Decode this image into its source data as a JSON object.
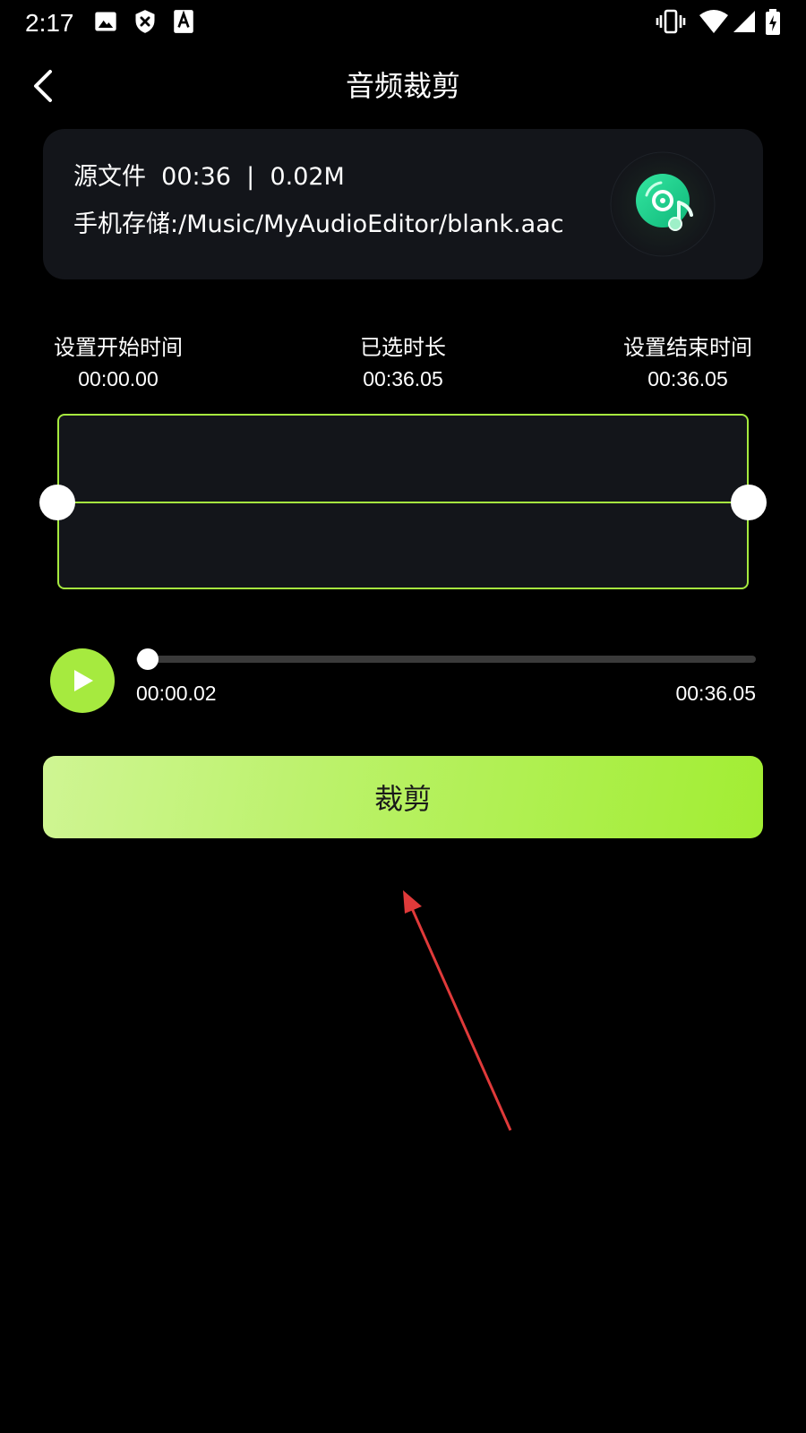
{
  "status_bar": {
    "time": "2:17",
    "left_icons": [
      "image-icon",
      "shield-x-icon",
      "font-a-icon"
    ],
    "right_icons": [
      "vibrate-icon",
      "wifi-icon",
      "signal-icon",
      "battery-charging-icon"
    ]
  },
  "header": {
    "title": "音频裁剪",
    "back_icon": "chevron-left-icon"
  },
  "file_card": {
    "label": "源文件",
    "duration": "00:36",
    "separator": "|",
    "size": "0.02M",
    "path": "手机存储:/Music/MyAudioEditor/blank.aac",
    "icon": "music-disc-icon"
  },
  "trim": {
    "start_label": "设置开始时间",
    "start_value": "00:00.00",
    "selected_label": "已选时长",
    "selected_value": "00:36.05",
    "end_label": "设置结束时间",
    "end_value": "00:36.05"
  },
  "player": {
    "play_icon": "play-icon",
    "current_time": "00:00.02",
    "total_time": "00:36.05",
    "progress_fraction": 0.001
  },
  "actions": {
    "crop_label": "裁剪"
  },
  "colors": {
    "accent": "#a6ea3f",
    "card_bg": "#13151a",
    "background": "#000000",
    "annotation": "#e03a3a"
  }
}
